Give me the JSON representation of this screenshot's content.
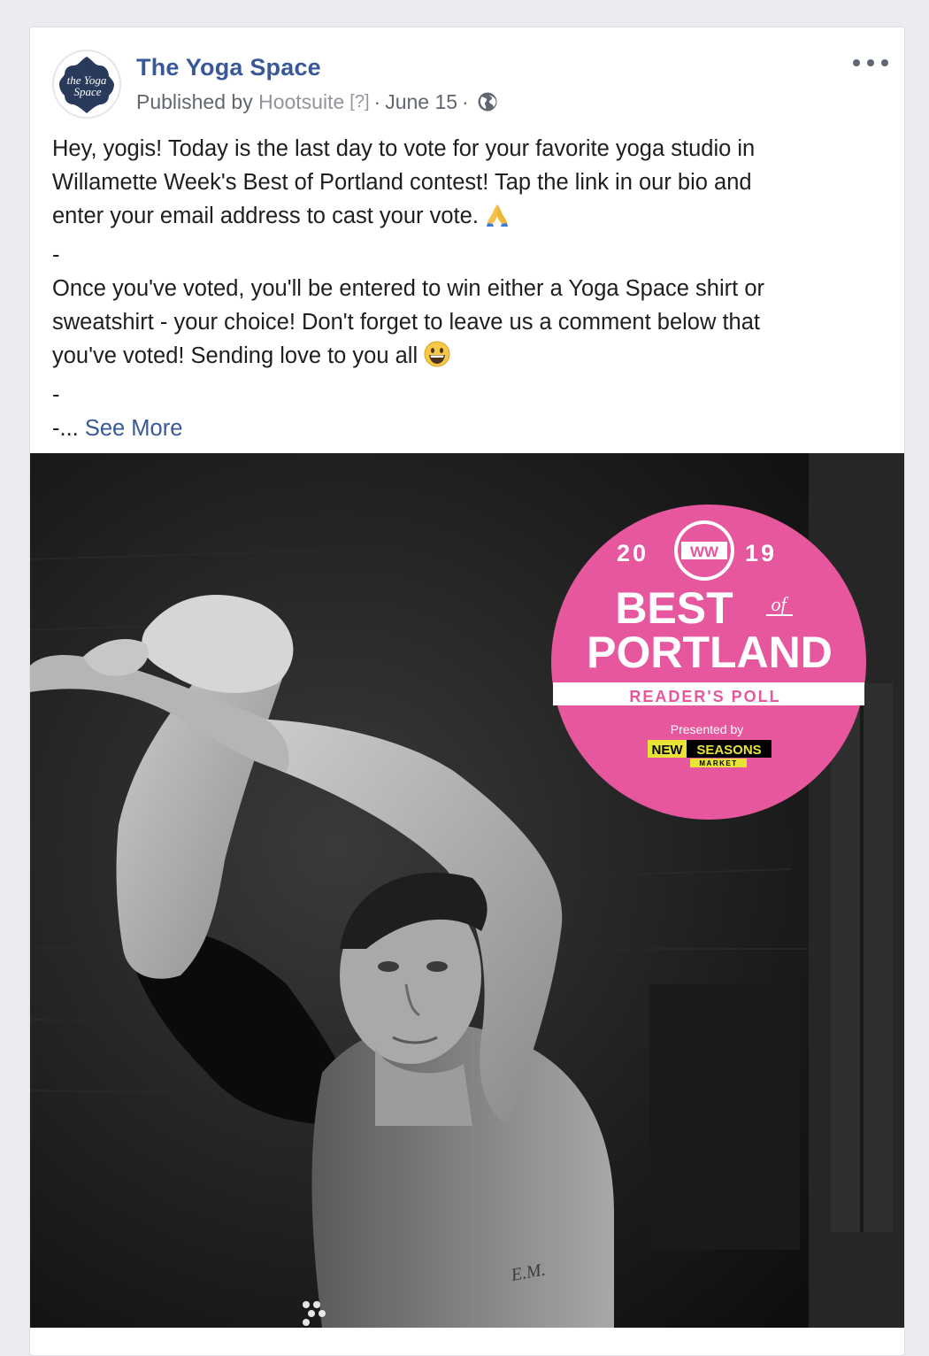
{
  "post": {
    "page_name": "The Yoga Space",
    "published_by_label": "Published by",
    "published_by_app": "Hootsuite",
    "help_label": "[?]",
    "date": "June 15",
    "separator": "·",
    "privacy_icon": "globe-icon",
    "menu_icon": "more-options-icon",
    "avatar_text_line1": "the Yoga",
    "avatar_text_line2": "Space",
    "text_lines": [
      "Hey, yogis! Today is the last day to vote for your favorite yoga studio in",
      "Willamette Week's Best of Portland contest! Tap the link in our bio and",
      "enter your email address to cast your vote.",
      "-",
      "Once you've voted, you'll be entered to win either a Yoga Space shirt or",
      "sweatshirt - your choice! Don't forget to leave us a comment below that",
      "you've voted! Sending love to you all",
      "-",
      "-..."
    ],
    "emoji_pray": "folded-hands-emoji",
    "emoji_smile": "grinning-face-emoji",
    "see_more_label": "See More"
  },
  "badge": {
    "year_left": "20",
    "year_right": "19",
    "ww_logo": "WW",
    "best": "BEST",
    "of": "of",
    "portland": "PORTLAND",
    "readers_poll": "READER'S POLL",
    "presented_by": "Presented by",
    "sponsor_word1": "NEW",
    "sponsor_word2": "SEASONS",
    "sponsor_word3": "MARKET",
    "badge_color": "#e6579d",
    "sponsor_color": "#e8e336"
  },
  "photo_marks": {
    "tattoo_initials": "E.M."
  },
  "colors": {
    "link_blue": "#385898",
    "meta_gray": "#616770",
    "text": "#1c1e21"
  }
}
